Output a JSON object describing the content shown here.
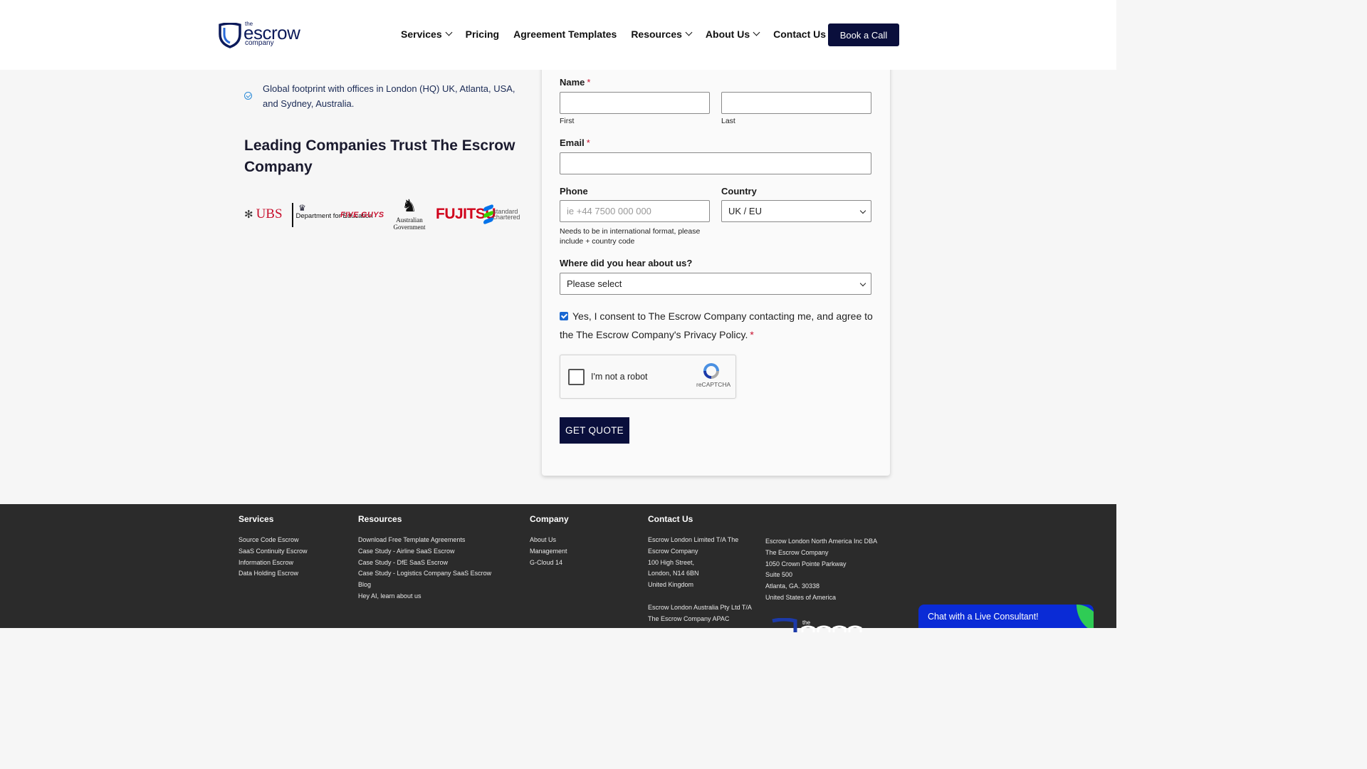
{
  "header": {
    "logo": {
      "the": "the",
      "escrow": "escrow",
      "company": "company"
    },
    "nav": [
      {
        "label": "Services",
        "dropdown": true
      },
      {
        "label": "Pricing",
        "dropdown": false
      },
      {
        "label": "Agreement Templates",
        "dropdown": false
      },
      {
        "label": "Resources",
        "dropdown": true
      },
      {
        "label": "About Us",
        "dropdown": true
      },
      {
        "label": "Contact Us",
        "dropdown": false
      }
    ],
    "cta_label": "Book a Call"
  },
  "left": {
    "bullet_text": "Global footprint with offices in London (HQ) UK, Atlanta, USA, and Sydney, Australia.",
    "trust_heading": "Leading Companies Trust The Escrow Company",
    "client_logos": {
      "ubs": "UBS",
      "dfe": "Department for Education",
      "fiveguys": "FIVE GUYS",
      "ausgov": "Australian Government",
      "fujitsu": "FUJITSU",
      "stdchart": "standard chartered"
    }
  },
  "form": {
    "name_label": "Name",
    "required_mark": "*",
    "first_sub": "First",
    "last_sub": "Last",
    "first_value": "",
    "last_value": "",
    "email_label": "Email",
    "email_value": "",
    "phone_label": "Phone",
    "phone_placeholder": "ie +44 7500 000 000",
    "phone_help": "Needs to be in international format, please include + country code",
    "country_label": "Country",
    "country_value": "UK / EU",
    "hear_label": "Where did you hear about us?",
    "hear_value": "Please select",
    "consent_text": "Yes, I consent to The Escrow Company contacting me, and agree to the The Escrow Company's Privacy Policy.",
    "consent_checked": true,
    "captcha_label": "I'm not a robot",
    "captcha_brand": "reCAPTCHA",
    "submit_label": "GET QUOTE"
  },
  "footer": {
    "services": {
      "heading": "Services",
      "links": [
        "Source Code Escrow",
        "SaaS Continuity Escrow",
        "Information Escrow",
        "Data Holding Escrow"
      ]
    },
    "resources": {
      "heading": "Resources",
      "links": [
        "Download Free Template Agreements",
        "Case Study - Airline SaaS Escrow",
        "Case Study - DfE SaaS Escrow",
        "Case Study - Logistics Company SaaS Escrow",
        "Blog",
        "Hey AI, learn about us"
      ]
    },
    "company": {
      "heading": "Company",
      "links": [
        "About Us",
        "Management",
        "G-Cloud 14"
      ]
    },
    "contact": {
      "heading": "Contact Us",
      "london": [
        "Escrow London Limited T/A The",
        "Escrow Company",
        "100 High Street,",
        "London, N14 6BN",
        "United Kingdom"
      ],
      "australia": [
        "Escrow London Australia Pty Ltd T/A",
        "The Escrow Company APAC"
      ],
      "north_america": [
        "Escrow London North America Inc DBA",
        "The Escrow Company",
        "1050 Crown Pointe Parkway",
        "Suite 500",
        "Atlanta, GA. 30338",
        "United States of America"
      ]
    }
  },
  "chat": {
    "label": "Chat with a Live Consultant!"
  },
  "colors": {
    "navy": "#0a0f3c",
    "required": "#c8102e",
    "footer_bg": "#2b2b2b",
    "chat_blue": "#0a2bd6",
    "chat_green": "#2fcc55"
  }
}
